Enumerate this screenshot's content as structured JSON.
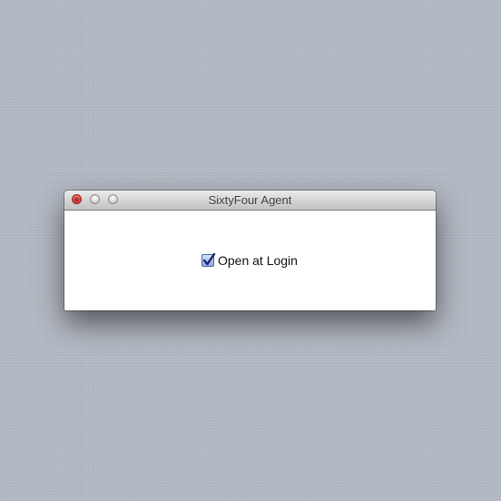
{
  "window": {
    "title": "SixtyFour Agent",
    "controls": {
      "close_icon": "close-icon",
      "minimize_icon": "minimize-icon",
      "zoom_icon": "zoom-icon"
    }
  },
  "content": {
    "open_at_login": {
      "label": "Open at Login",
      "checked": true
    }
  },
  "colors": {
    "desktop": "#b4bac4",
    "close_button": "#f3504a",
    "checkbox_fill": "#86aee9",
    "checkmark": "#1a2070"
  }
}
